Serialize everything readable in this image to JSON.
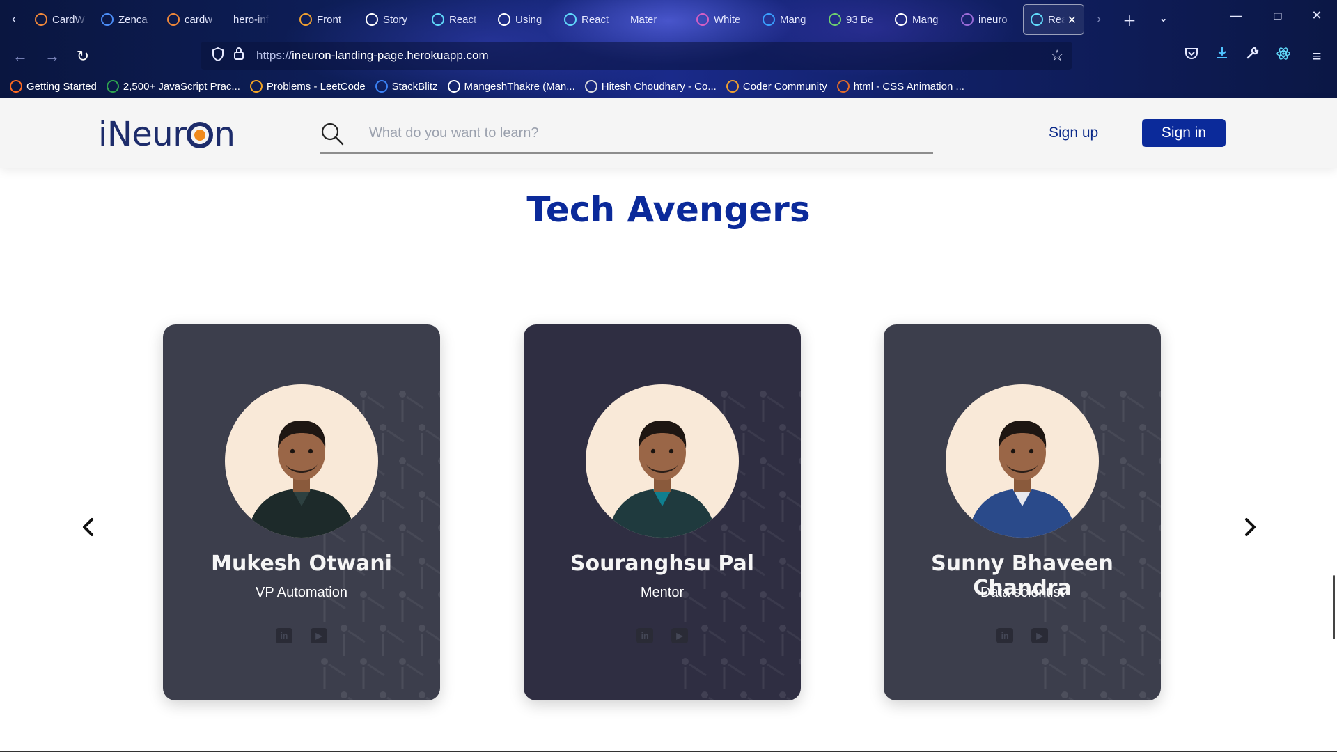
{
  "browser": {
    "tabs": [
      {
        "label": "CardW",
        "icon": "orange-bird-icon",
        "color": "#f0883a"
      },
      {
        "label": "Zenca",
        "icon": "globe-icon",
        "color": "#4b8df8"
      },
      {
        "label": "cardw",
        "icon": "orange-bird-icon",
        "color": "#f0883a"
      },
      {
        "label": "hero-influ",
        "icon": "",
        "color": ""
      },
      {
        "label": "Front",
        "icon": "braces-icon",
        "color": "#f0a030"
      },
      {
        "label": "Story",
        "icon": "star-icon",
        "color": "#ffffff"
      },
      {
        "label": "React",
        "icon": "react-icon",
        "color": "#61dafb"
      },
      {
        "label": "Using",
        "icon": "m-icon",
        "color": "#ffffff"
      },
      {
        "label": "React",
        "icon": "react-icon",
        "color": "#61dafb"
      },
      {
        "label": "Mater",
        "icon": "",
        "color": ""
      },
      {
        "label": "White",
        "icon": "drop-icon",
        "color": "#d65fc4"
      },
      {
        "label": "Mang",
        "icon": "code-icon",
        "color": "#3aa0ff"
      },
      {
        "label": "93 Be",
        "icon": "r-icon",
        "color": "#6fd06f"
      },
      {
        "label": "Mang",
        "icon": "github-icon",
        "color": "#ffffff"
      },
      {
        "label": "ineuro",
        "icon": "h-icon",
        "color": "#9a6bd8"
      },
      {
        "label": "Rea",
        "icon": "react-icon",
        "color": "#61dafb",
        "active": true
      }
    ],
    "url_protocol": "https://",
    "url_host": "ineuron-landing-page.herokuapp.com",
    "bookmarks": [
      {
        "label": "Getting Started",
        "color": "#ff6a21"
      },
      {
        "label": "2,500+ JavaScript Prac...",
        "color": "#2ea44f"
      },
      {
        "label": "Problems - LeetCode",
        "color": "#f5a623"
      },
      {
        "label": "StackBlitz",
        "color": "#3b82f6"
      },
      {
        "label": "MangeshThakre (Man...",
        "color": "#ffffff"
      },
      {
        "label": "Hitesh Choudhary - Co...",
        "color": "#dddddd"
      },
      {
        "label": "Coder Community",
        "color": "#f0a030"
      },
      {
        "label": "html - CSS Animation ...",
        "color": "#e06b2a"
      }
    ]
  },
  "header": {
    "logo_text_before": "iNeur",
    "logo_text_after": "n",
    "search_placeholder": "What do you want to learn?",
    "signup_label": "Sign up",
    "signin_label": "Sign in"
  },
  "main": {
    "title": "Tech Avengers",
    "cards": [
      {
        "name": "Mukesh Otwani",
        "role": "VP Automation",
        "bg": "#3c3e4c"
      },
      {
        "name": "Souranghsu Pal",
        "role": "Mentor",
        "bg": "#2f2e42"
      },
      {
        "name": "Sunny Bhaveen Chandra",
        "role": "Data scientist",
        "bg": "#3c3e4c"
      }
    ]
  },
  "colors": {
    "accent": "#0b2a9a",
    "logo_orange": "#f08a1c"
  }
}
